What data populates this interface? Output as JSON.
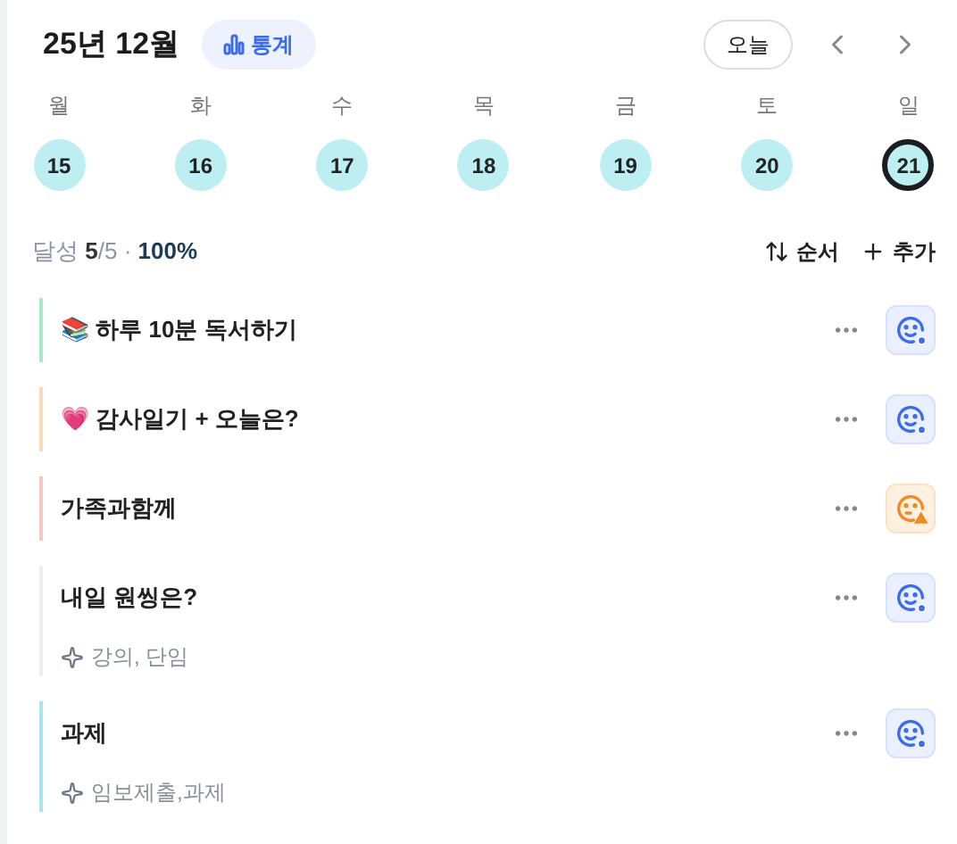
{
  "header": {
    "month": "25년 12월",
    "stats_button": "통계",
    "today_button": "오늘"
  },
  "days": [
    {
      "weekday": "월",
      "date": "15",
      "selected": false
    },
    {
      "weekday": "화",
      "date": "16",
      "selected": false
    },
    {
      "weekday": "수",
      "date": "17",
      "selected": false
    },
    {
      "weekday": "목",
      "date": "18",
      "selected": false
    },
    {
      "weekday": "금",
      "date": "19",
      "selected": false
    },
    {
      "weekday": "토",
      "date": "20",
      "selected": false
    },
    {
      "weekday": "일",
      "date": "21",
      "selected": true
    }
  ],
  "summary": {
    "label": "달성",
    "done": "5",
    "total": "/5",
    "separator": "·",
    "percent": "100%",
    "order_button": "순서",
    "add_button": "추가"
  },
  "habits": [
    {
      "title": "📚 하루 10분 독서하기",
      "color": "#a7e8c8",
      "kind": "good"
    },
    {
      "title": "💗 감사일기 + 오늘은?",
      "color": "#fcd9b8",
      "kind": "good"
    },
    {
      "title": "가족과함께",
      "color": "#f9c4c4",
      "kind": "warning"
    },
    {
      "title": "내일 원씽은?",
      "color": "#eeeeee",
      "kind": "good",
      "tags": "강의, 단임"
    },
    {
      "title": "과제",
      "color": "#a9e4ee",
      "kind": "good",
      "tags": "임보제출,과제"
    }
  ]
}
